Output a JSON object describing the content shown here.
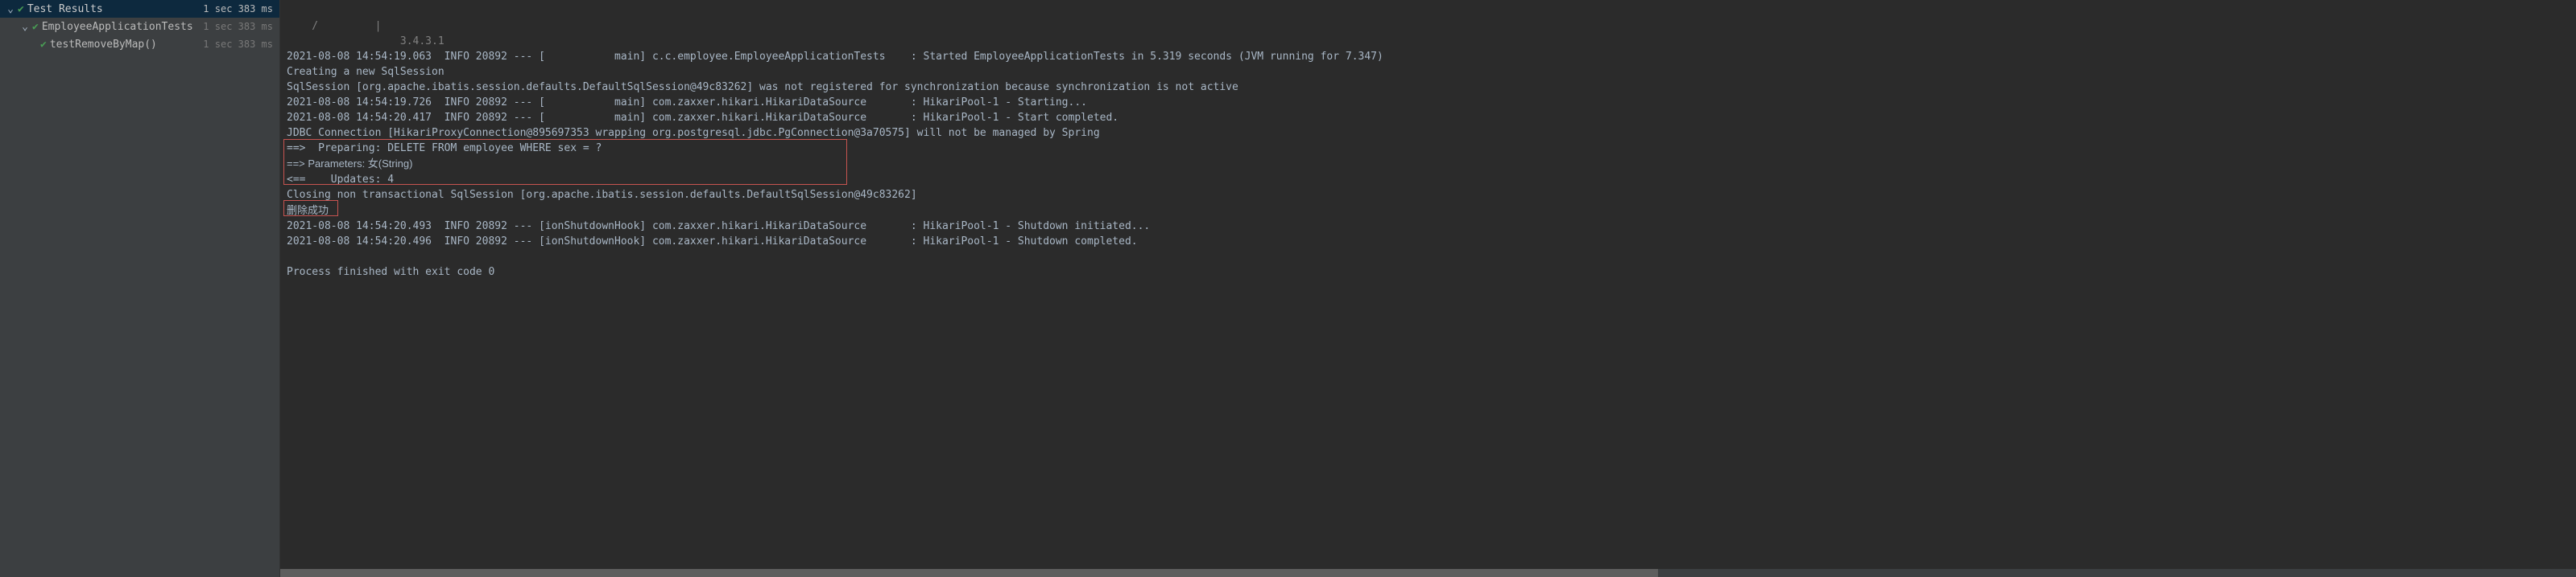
{
  "sidebar": {
    "root": {
      "label": "Test Results",
      "time": "1 sec 383 ms"
    },
    "items": [
      {
        "label": "EmployeeApplicationTests",
        "time": "1 sec 383 ms"
      },
      {
        "label": "testRemoveByMap()",
        "time": "1 sec 383 ms"
      }
    ]
  },
  "console": {
    "ascii_line1": "    /         |",
    "ascii_line2": "                  3.4.3.1",
    "lines": [
      "2021-08-08 14:54:19.063  INFO 20892 --- [           main] c.c.employee.EmployeeApplicationTests    : Started EmployeeApplicationTests in 5.319 seconds (JVM running for 7.347)",
      "Creating a new SqlSession",
      "SqlSession [org.apache.ibatis.session.defaults.DefaultSqlSession@49c83262] was not registered for synchronization because synchronization is not active",
      "2021-08-08 14:54:19.726  INFO 20892 --- [           main] com.zaxxer.hikari.HikariDataSource       : HikariPool-1 - Starting...",
      "2021-08-08 14:54:20.417  INFO 20892 --- [           main] com.zaxxer.hikari.HikariDataSource       : HikariPool-1 - Start completed.",
      "JDBC Connection [HikariProxyConnection@895697353 wrapping org.postgresql.jdbc.PgConnection@3a70575] will not be managed by Spring",
      "==>  Preparing: DELETE FROM employee WHERE sex = ?",
      "==> Parameters: 女(String)",
      "<==    Updates: 4",
      "Closing non transactional SqlSession [org.apache.ibatis.session.defaults.DefaultSqlSession@49c83262]",
      "删除成功",
      "2021-08-08 14:54:20.493  INFO 20892 --- [ionShutdownHook] com.zaxxer.hikari.HikariDataSource       : HikariPool-1 - Shutdown initiated...",
      "2021-08-08 14:54:20.496  INFO 20892 --- [ionShutdownHook] com.zaxxer.hikari.HikariDataSource       : HikariPool-1 - Shutdown completed.",
      "",
      "Process finished with exit code 0"
    ]
  }
}
